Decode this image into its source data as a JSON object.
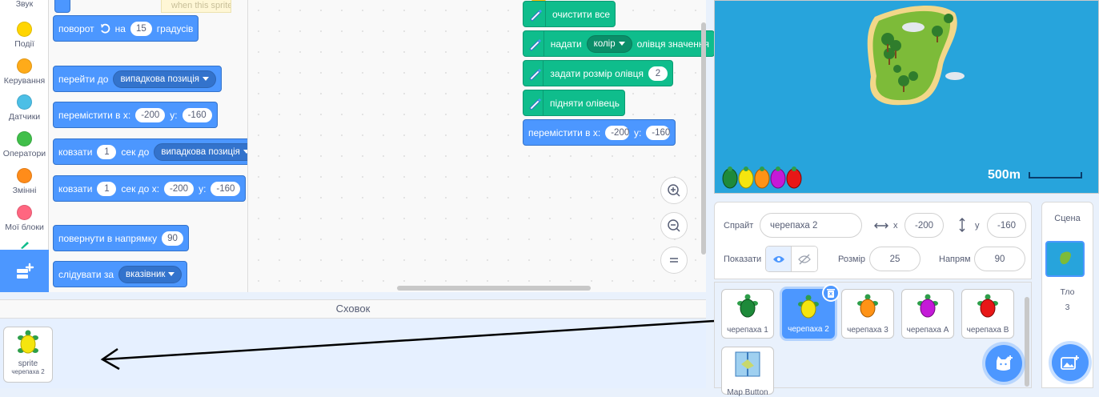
{
  "categories": [
    {
      "label": "Звук",
      "color": "#cf63cf"
    },
    {
      "label": "Події",
      "color": "#ffd500"
    },
    {
      "label": "Керування",
      "color": "#ffab19"
    },
    {
      "label": "Датчики",
      "color": "#4cbfe6"
    },
    {
      "label": "Оператори",
      "color": "#40bf4a"
    },
    {
      "label": "Змінні",
      "color": "#ff8c1a"
    },
    {
      "label": "Мої блоки",
      "color": "#ff6680"
    }
  ],
  "palette": {
    "top_partial": "when this sprite clicked",
    "turn": {
      "label": "поворот",
      "value": "15",
      "suffix": "градусів"
    },
    "goto": {
      "label": "перейти до",
      "target": "випадкова позиція"
    },
    "goto_xy": {
      "label": "перемістити в x:",
      "x": "-200",
      "ylabel": "y:",
      "y": "-160"
    },
    "glide_to": {
      "label": "ковзати",
      "secs": "1",
      "mid": "сек до",
      "target": "випадкова позиція"
    },
    "glide_xy": {
      "label": "ковзати",
      "secs": "1",
      "mid": "сек до x:",
      "x": "-200",
      "ylabel": "y:",
      "y": "-160"
    },
    "point_dir": {
      "label": "повернути в напрямку",
      "value": "90"
    },
    "point_towards": {
      "label": "слідувати за",
      "target": "вказівник"
    }
  },
  "script": {
    "clear": "очистити все",
    "set_pen": {
      "label": "надати",
      "param": "колір",
      "suffix": "олівця значення"
    },
    "pen_size": {
      "label": "задати розмір олівця",
      "value": "2"
    },
    "pen_up": "підняти олівець",
    "goto_xy": {
      "label": "перемістити в x:",
      "x": "-200",
      "ylabel": "y:",
      "y": "-160"
    }
  },
  "backpack": {
    "title": "Сховок",
    "item_name": "sprite",
    "item_sub": "черепаха 2"
  },
  "stage": {
    "scale_label": "500m",
    "turtle_colors": [
      "#1e8a3a",
      "#f5e50f",
      "#ff9316",
      "#c41ad8",
      "#e81717"
    ]
  },
  "sprite_info": {
    "sprite_label": "Спрайт",
    "sprite_name": "черепаха 2",
    "x_label": "x",
    "x": "-200",
    "y_label": "y",
    "y": "-160",
    "show_label": "Показати",
    "size_label": "Розмір",
    "size": "25",
    "direction_label": "Напрям",
    "direction": "90"
  },
  "sprites": [
    {
      "name": "черепаха 1",
      "color": "#1e8a3a"
    },
    {
      "name": "черепаха 2",
      "color": "#f5e50f"
    },
    {
      "name": "черепаха 3",
      "color": "#ff9316"
    },
    {
      "name": "черепаха A",
      "color": "#c41ad8"
    },
    {
      "name": "черепаха B",
      "color": "#e81717"
    },
    {
      "name": "Map Button",
      "color": "#4c97ff"
    }
  ],
  "stage_panel": {
    "title": "Сцена",
    "backdrops_label": "Тло",
    "backdrops_count": "3"
  }
}
